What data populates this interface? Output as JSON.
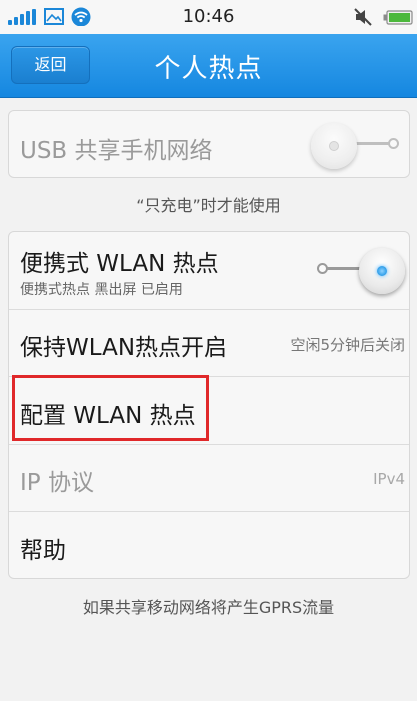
{
  "status_bar": {
    "time": "10:46",
    "icons": [
      "signal-icon",
      "image-icon",
      "wifi-icon",
      "mute-icon",
      "battery-icon"
    ]
  },
  "header": {
    "back_label": "返回",
    "title": "个人热点"
  },
  "usb_section": {
    "title": "USB 共享手机网络",
    "enabled": false,
    "caption": "“只充电”时才能使用"
  },
  "wlan_section": {
    "items": [
      {
        "title": "便携式 WLAN 热点",
        "subtitle": "便携式热点 黑出屏 已启用",
        "toggle": true
      },
      {
        "title": "保持WLAN热点开启",
        "value": "空闲5分钟后关闭"
      },
      {
        "title": "配置 WLAN 热点"
      },
      {
        "title": "IP 协议",
        "value": "IPv4",
        "disabled": true
      },
      {
        "title": "帮助"
      }
    ]
  },
  "footer_note": "如果共享移动网络将产生GPRS流量",
  "colors": {
    "header_blue": "#1587e0",
    "highlight_red": "#e0282a",
    "toggle_on_dot": "#2a9be8"
  }
}
